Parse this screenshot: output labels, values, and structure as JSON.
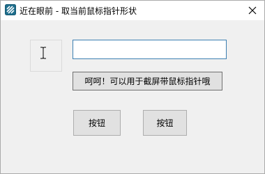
{
  "window": {
    "title": "近在眼前 - 取当前鼠标指针形状",
    "app_icon": "app-logo-icon",
    "close_icon": "close-icon"
  },
  "cursor_preview": {
    "icon": "text-cursor-ibeam-icon"
  },
  "text_input": {
    "value": "",
    "placeholder": ""
  },
  "buttons": {
    "capture_label": "呵呵！可以用于截屏带鼠标指针哦",
    "button1_label": "按钮",
    "button2_label": "按钮"
  },
  "colors": {
    "accent": "#3c7fb1",
    "app_icon": "#1f6e8c"
  }
}
